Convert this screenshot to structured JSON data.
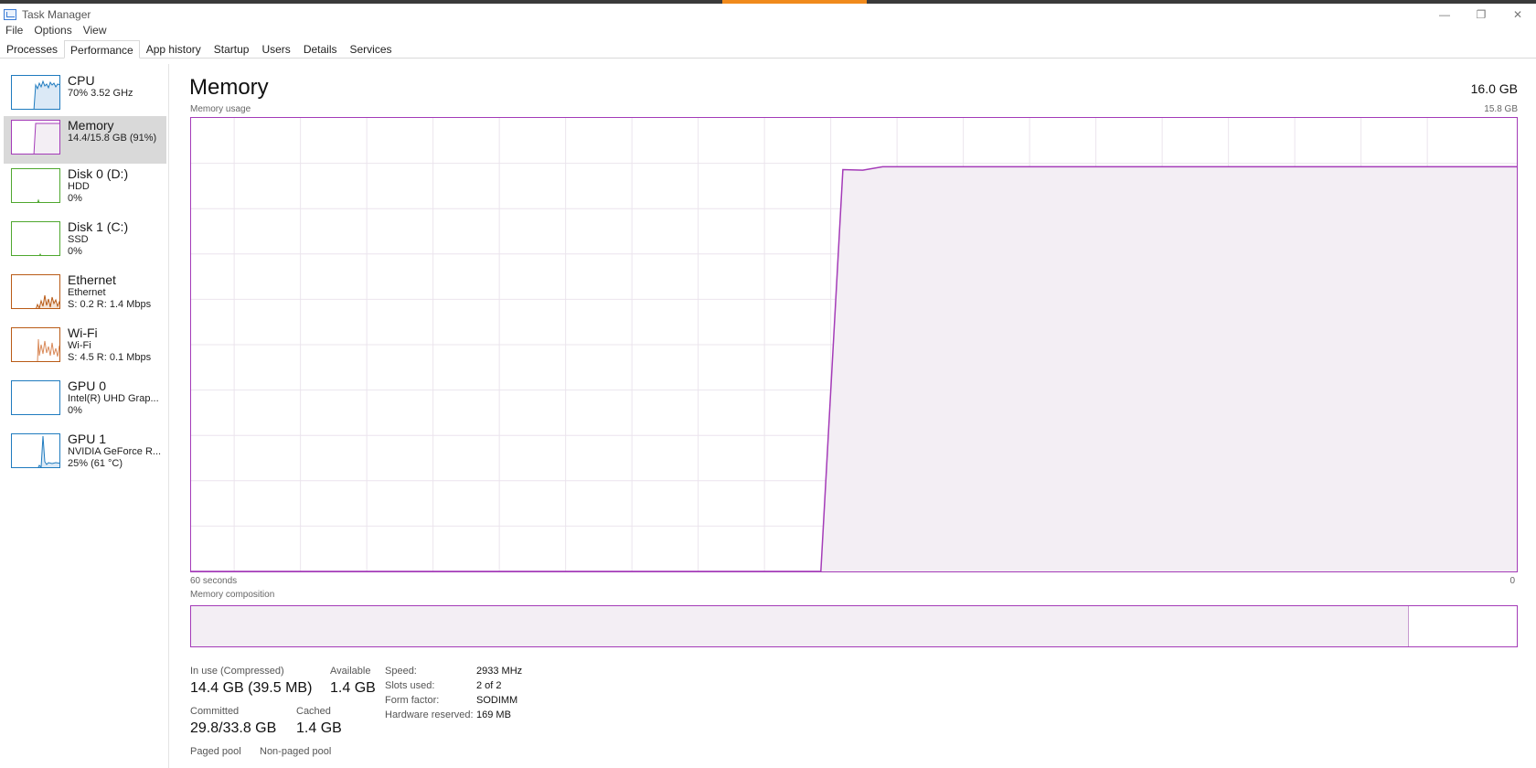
{
  "window": {
    "title": "Task Manager"
  },
  "menu": [
    "File",
    "Options",
    "View"
  ],
  "tabs": [
    "Processes",
    "Performance",
    "App history",
    "Startup",
    "Users",
    "Details",
    "Services"
  ],
  "sidebar": [
    {
      "name": "CPU",
      "sub1": "70% 3.52 GHz",
      "sub2": ""
    },
    {
      "name": "Memory",
      "sub1": "14.4/15.8 GB (91%)",
      "sub2": ""
    },
    {
      "name": "Disk 0 (D:)",
      "sub1": "HDD",
      "sub2": "0%"
    },
    {
      "name": "Disk 1 (C:)",
      "sub1": "SSD",
      "sub2": "0%"
    },
    {
      "name": "Ethernet",
      "sub1": "Ethernet",
      "sub2": "S: 0.2  R: 1.4 Mbps"
    },
    {
      "name": "Wi-Fi",
      "sub1": "Wi-Fi",
      "sub2": "S: 4.5  R: 0.1 Mbps"
    },
    {
      "name": "GPU 0",
      "sub1": "Intel(R) UHD Grap...",
      "sub2": "0%"
    },
    {
      "name": "GPU 1",
      "sub1": "NVIDIA GeForce R...",
      "sub2": "25% (61 °C)"
    }
  ],
  "main": {
    "title": "Memory",
    "total": "16.0 GB",
    "usage_label": "Memory usage",
    "usage_max": "15.8 GB",
    "time_left": "60 seconds",
    "time_right": "0",
    "composition_label": "Memory composition"
  },
  "stats": {
    "in_use_label": "In use (Compressed)",
    "in_use_value": "14.4 GB (39.5 MB)",
    "available_label": "Available",
    "available_value": "1.4 GB",
    "committed_label": "Committed",
    "committed_value": "29.8/33.8 GB",
    "cached_label": "Cached",
    "cached_value": "1.4 GB",
    "paged_label": "Paged pool",
    "nonpaged_label": "Non-paged pool"
  },
  "specs": {
    "speed_label": "Speed:",
    "speed_value": "2933 MHz",
    "slots_label": "Slots used:",
    "slots_value": "2 of 2",
    "form_label": "Form factor:",
    "form_value": "SODIMM",
    "reserved_label": "Hardware reserved:",
    "reserved_value": "169 MB"
  },
  "colors": {
    "memory": "#a43bb8",
    "cpu": "#1f7bbf",
    "disk": "#4ea72e",
    "network": "#b95b16"
  },
  "chart_data": {
    "type": "area",
    "x": [
      60,
      31.5,
      30.5,
      29.6,
      28.7,
      27.8,
      24,
      20,
      15,
      10,
      5,
      0
    ],
    "values": [
      0,
      0,
      14.0,
      13.98,
      14.1,
      14.1,
      14.1,
      14.1,
      14.1,
      14.1,
      14.1,
      14.1
    ],
    "xlabel": "",
    "ylabel": "",
    "xlim": [
      60,
      0
    ],
    "ylim": [
      0,
      15.8
    ],
    "grid": true,
    "composition": {
      "in_use": 14.4,
      "available": 1.4
    }
  }
}
